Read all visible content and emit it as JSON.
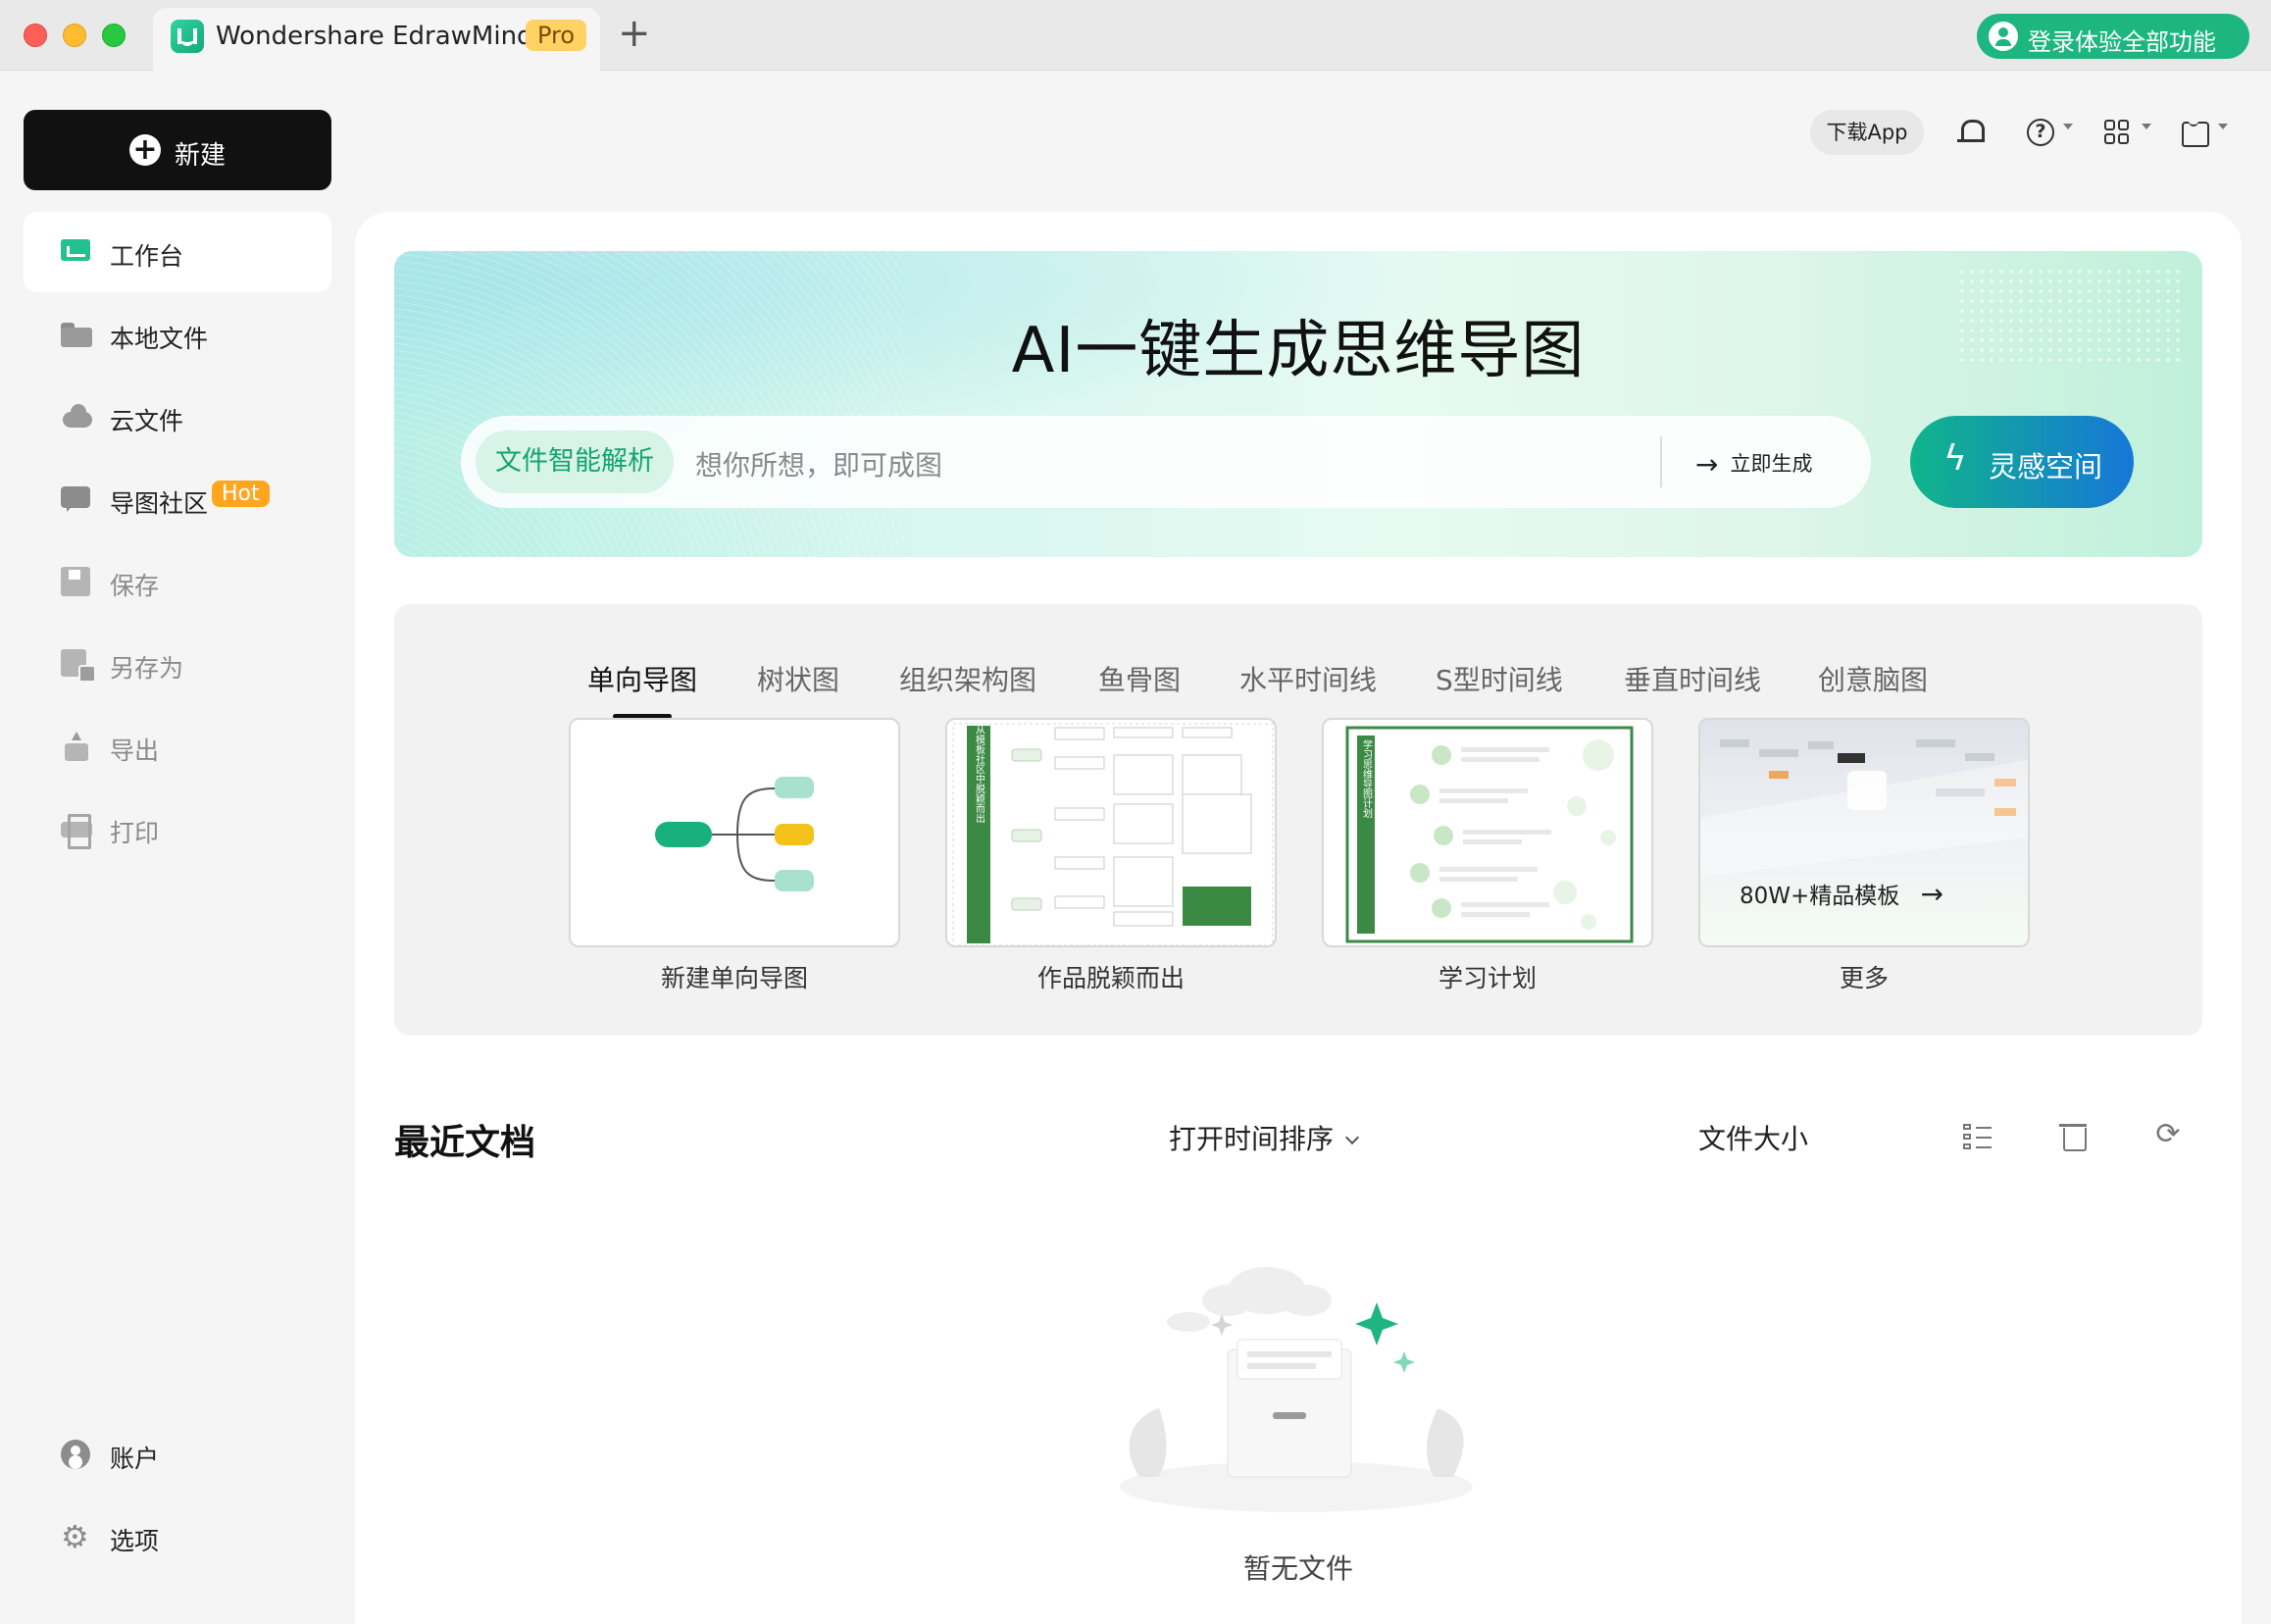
{
  "window": {
    "app_name": "Wondershare EdrawMind",
    "pro_badge": "Pro",
    "new_tab_glyph": "+",
    "login_label": "登录体验全部功能"
  },
  "sidebar": {
    "new_label": "新建",
    "items": [
      {
        "label": "工作台",
        "icon": "workspace-icon"
      },
      {
        "label": "本地文件",
        "icon": "folder-icon"
      },
      {
        "label": "云文件",
        "icon": "cloud-icon"
      },
      {
        "label": "导图社区",
        "icon": "community-icon",
        "badge": "Hot"
      },
      {
        "label": "保存",
        "icon": "save-icon"
      },
      {
        "label": "另存为",
        "icon": "save-as-icon"
      },
      {
        "label": "导出",
        "icon": "export-icon"
      },
      {
        "label": "打印",
        "icon": "print-icon"
      }
    ],
    "bottom": [
      {
        "label": "账户",
        "icon": "account-icon"
      },
      {
        "label": "选项",
        "icon": "gear-icon"
      }
    ]
  },
  "toolbar": {
    "download_app": "下载App"
  },
  "ai": {
    "title": "AI一键生成思维导图",
    "file_parse": "文件智能解析",
    "placeholder": "想你所想，即可成图",
    "generate_now": "立即生成",
    "inspire": "灵感空间"
  },
  "templates": {
    "tabs": [
      "单向导图",
      "树状图",
      "组织架构图",
      "鱼骨图",
      "水平时间线",
      "S型时间线",
      "垂直时间线",
      "创意脑图"
    ],
    "active_tab": 0,
    "cards": [
      {
        "label": "新建单向导图"
      },
      {
        "label": "作品脱颖而出"
      },
      {
        "label": "学习计划"
      },
      {
        "label": "更多",
        "overlay": "80W+精品模板"
      }
    ],
    "thumb_text": {
      "vertical_1": "如何让作品从模板社区中脱颖而出",
      "vertical_2": "学习思维导图计划"
    }
  },
  "recent": {
    "title": "最近文档",
    "sort_label": "打开时间排序",
    "size_label": "文件大小",
    "empty_text": "暂无文件"
  },
  "colors": {
    "accent_green": "#1db680",
    "hot_badge": "#ffa61e",
    "pro_badge": "#ffd363"
  }
}
